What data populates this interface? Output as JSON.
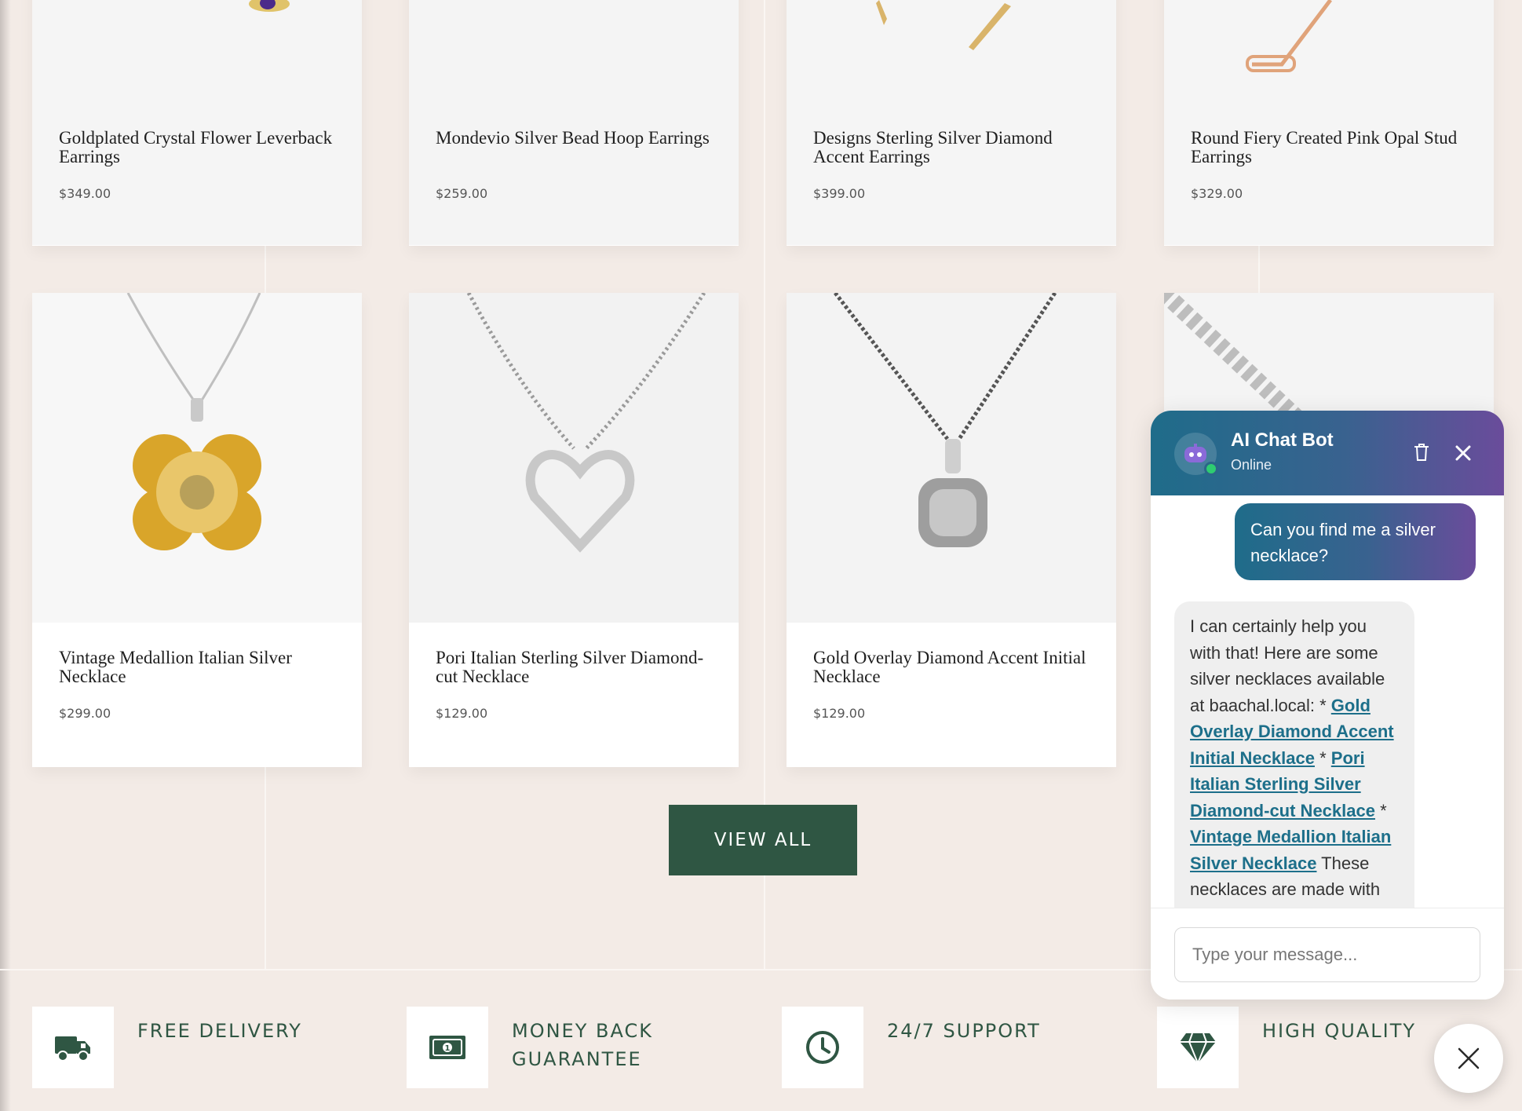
{
  "products": [
    {
      "title": "Goldplated Crystal Flower Leverback Earrings",
      "price": "$349.00"
    },
    {
      "title": "Mondevio Silver Bead Hoop Earrings",
      "price": "$259.00"
    },
    {
      "title": "Designs Sterling Silver Diamond Accent Earrings",
      "price": "$399.00"
    },
    {
      "title": "Round Fiery Created Pink Opal Stud Earrings",
      "price": "$329.00"
    },
    {
      "title": "Vintage Medallion Italian Silver Necklace",
      "price": "$299.00"
    },
    {
      "title": "Pori Italian Sterling Silver Diamond-cut Necklace",
      "price": "$129.00"
    },
    {
      "title": "Gold Overlay Diamond Accent Initial Necklace",
      "price": "$129.00"
    }
  ],
  "view_all_label": "VIEW ALL",
  "features": [
    {
      "icon": "truck-icon",
      "label": "FREE DELIVERY"
    },
    {
      "icon": "cash-icon",
      "label": "MONEY BACK GUARANTEE"
    },
    {
      "icon": "clock-icon",
      "label": "24/7 SUPPORT"
    },
    {
      "icon": "diamond-icon",
      "label": "HIGH QUALITY"
    }
  ],
  "chat": {
    "name": "AI Chat Bot",
    "status": "Online",
    "user_message": "Can you find me a silver necklace?",
    "bot_intro": "I can certainly help you with that! Here are some silver necklaces available at baachal.local: * ",
    "bot_link_1": "Gold Overlay Diamond Accent Initial Necklace",
    "bot_sep_1": " * ",
    "bot_link_2": "Pori Italian Sterling Silver Diamond-cut Necklace",
    "bot_sep_2": " * ",
    "bot_link_3": "Vintage Medallion Italian Silver Necklace",
    "bot_tail": " These necklaces are made with",
    "input_placeholder": "Type your message..."
  },
  "colors": {
    "page_bg": "#f3ebe6",
    "accent_green": "#2f5643",
    "chat_gradient_start": "#1f6c8a",
    "chat_gradient_end": "#6a4c9b",
    "link": "#1d6f8a"
  }
}
